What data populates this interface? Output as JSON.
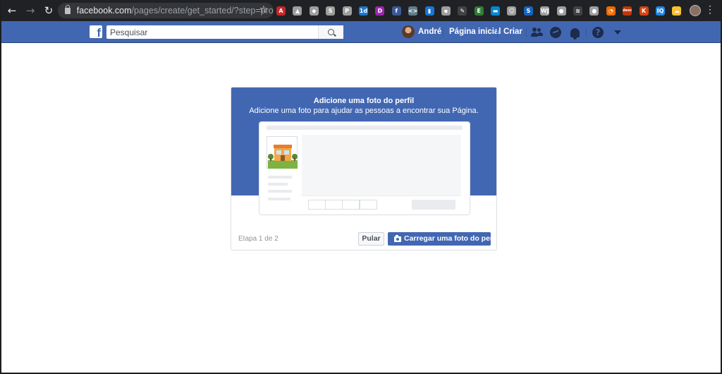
{
  "browser": {
    "url_host": "facebook.com",
    "url_path": "/pages/create/get_started/?step=pro...",
    "extensions": [
      {
        "name": "adobe-pdf-icon",
        "color": "#c62828",
        "glyph": "A"
      },
      {
        "name": "google-drive-icon",
        "color": "#9e9e9e",
        "glyph": "▲"
      },
      {
        "name": "diamond-icon",
        "color": "#9e9e9e",
        "glyph": "◆"
      },
      {
        "name": "s-extension-icon",
        "color": "#9e9e9e",
        "glyph": "S"
      },
      {
        "name": "pinterest-icon",
        "color": "#9e9e9e",
        "glyph": "P"
      },
      {
        "name": "calendar-icon",
        "color": "#1976d2",
        "glyph": "1d"
      },
      {
        "name": "d-extension-icon",
        "color": "#9c27b0",
        "glyph": "D"
      },
      {
        "name": "facebook-extension-icon",
        "color": "#3b5998",
        "glyph": "f"
      },
      {
        "name": "code-icon",
        "color": "#607d8b",
        "glyph": "<>"
      },
      {
        "name": "tab-icon",
        "color": "#1976d2",
        "glyph": "▮"
      },
      {
        "name": "chat-icon",
        "color": "#9e9e9e",
        "glyph": "▪"
      },
      {
        "name": "pen-icon",
        "color": "#424242",
        "glyph": "✎"
      },
      {
        "name": "evernote-icon",
        "color": "#2e7d32",
        "glyph": "E"
      },
      {
        "name": "window-icon",
        "color": "#0288d1",
        "glyph": "▬"
      },
      {
        "name": "face-icon",
        "color": "#9e9e9e",
        "glyph": "☺"
      },
      {
        "name": "s-square-icon",
        "color": "#1565c0",
        "glyph": "S"
      },
      {
        "name": "wj-icon",
        "color": "#9e9e9e",
        "glyph": "WJ"
      },
      {
        "name": "bird-icon",
        "color": "#9e9e9e",
        "glyph": "●"
      },
      {
        "name": "layers-icon",
        "color": "#424242",
        "glyph": "≋"
      },
      {
        "name": "smile-icon",
        "color": "#9e9e9e",
        "glyph": "●"
      },
      {
        "name": "clock-icon",
        "color": "#ef6c00",
        "glyph": "◔"
      },
      {
        "name": "desc-icon",
        "color": "#bf360c",
        "glyph": "desc"
      },
      {
        "name": "k-icon",
        "color": "#d84315",
        "glyph": "K"
      },
      {
        "name": "iq-icon",
        "color": "#1e88e5",
        "glyph": "IQ"
      },
      {
        "name": "speech-icon",
        "color": "#fbc02d",
        "glyph": "☁"
      }
    ]
  },
  "fb_header": {
    "logo": "f",
    "search_placeholder": "Pesquisar",
    "user_name": "André",
    "home_label": "Página inicial",
    "create_label": "Criar"
  },
  "card": {
    "title": "Adicione uma foto do perfil",
    "subtitle": "Adicione uma foto para ajudar as pessoas a encontrar sua Página.",
    "step_text": "Etapa 1 de 2",
    "skip_label": "Pular",
    "upload_label": "Carregar uma foto do perfil"
  }
}
